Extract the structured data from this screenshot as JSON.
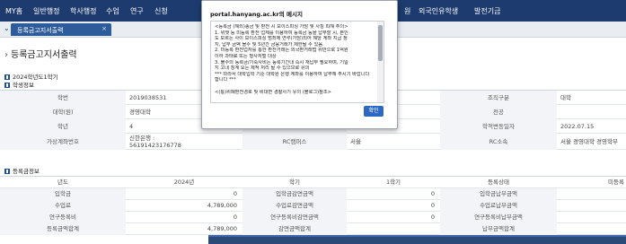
{
  "nav": {
    "items": [
      "MY홈",
      "일반행정",
      "학사행정",
      "수업",
      "연구",
      "신청",
      "원",
      "외국인유학생",
      "발전기금"
    ]
  },
  "tab": {
    "label": "등록금고지서출력",
    "close": "×"
  },
  "page": {
    "title": "등록금고지서출력",
    "gt": "›"
  },
  "student_section": {
    "line1": "2024학년도1학기",
    "line2": "학생정보"
  },
  "student_rows": [
    {
      "l1": "학번",
      "v1": "2019038531",
      "l2": "",
      "v2": "",
      "l3": "조직구분",
      "v3": "대학"
    },
    {
      "l1": "대학(원)",
      "v1": "경영대학",
      "l2": "",
      "v2": "",
      "l3": "전공",
      "v3": ""
    },
    {
      "l1": "학년",
      "v1": "4",
      "l2": "학적상태",
      "v2": "재학",
      "l3": "학적변동일자",
      "v3": "2022.07.15"
    },
    {
      "l1": "가상계좌번호",
      "v1a": "신한은행 :",
      "v1b": "56191423176778",
      "l2": "RC캠퍼스",
      "v2": "서울",
      "l3": "RC소속",
      "v3": "서울 경영대학 경영학부"
    }
  ],
  "tuition_section": {
    "label": "등록금정보"
  },
  "tuition_header": {
    "c1": "년도",
    "c2": "2024년",
    "c3": "학기",
    "c4": "1학기",
    "c5": "등록상태",
    "c6": "미등록"
  },
  "tuition_rows": [
    {
      "l1": "입학금",
      "v1": "0",
      "l2": "입학금감면금액",
      "v2": "0",
      "l3": "입학금납부금액",
      "v3": ""
    },
    {
      "l1": "수업료",
      "v1": "4,789,000",
      "l2": "수업료감면금액",
      "v2": "0",
      "l3": "수업료납부금액",
      "v3": ""
    },
    {
      "l1": "연구등록비",
      "v1": "0",
      "l2": "연구등록비감면금액",
      "v2": "0",
      "l3": "연구등록비납부금액",
      "v3": ""
    },
    {
      "l1": "등록금액합계",
      "v1": "4,789,000",
      "l2": "감면금액합계",
      "v2": "",
      "l3": "납부금액합계",
      "v3": ""
    }
  ],
  "dialog": {
    "title": "portal.hanyang.ac.kr의 메시지",
    "lines": [
      "<등록금 (해외)송금 및 환전 시 보이스피싱 가담 및 사칭 피해 주의>",
      "1. 위챗 등 미등록 환전 업체를 이용하여 등록금 등을 납부할 시, 본인",
      "도 모르는 사이 보이스피싱 범죄에 연루(가담)되어 해당 계좌 지급 정",
      "지, 납부 금액 몰수 및 5년간 금융거래가 제한될 수 있음.",
      "2. 미등록 환전업자를 통한 환전거래는 외국환거래법 위반으로 1억원",
      "이하 과태료 또는 형사처벌 대상",
      "3. 불수의 등록금/기숙사비는 등록기간내 즉시 재납부 필요하며, 기일",
      "지 고내 징계 요는 제적 처리 될 수 있으므로 유의",
      "*** 따라서 대학입학 기준 대학원 은행 계좌를 이용하여 납부해 주시기 바랍니다",
      "합니다 ***",
      "",
      "<(통)위폐환전경로 및 비대면 경찰사기 유의 (블로그)참조>"
    ],
    "ok": "확인"
  },
  "colors": {
    "nav_bg": "#1d3b6e",
    "tab_bg": "#2e5b9a",
    "ok_button": "#2d67c4"
  }
}
